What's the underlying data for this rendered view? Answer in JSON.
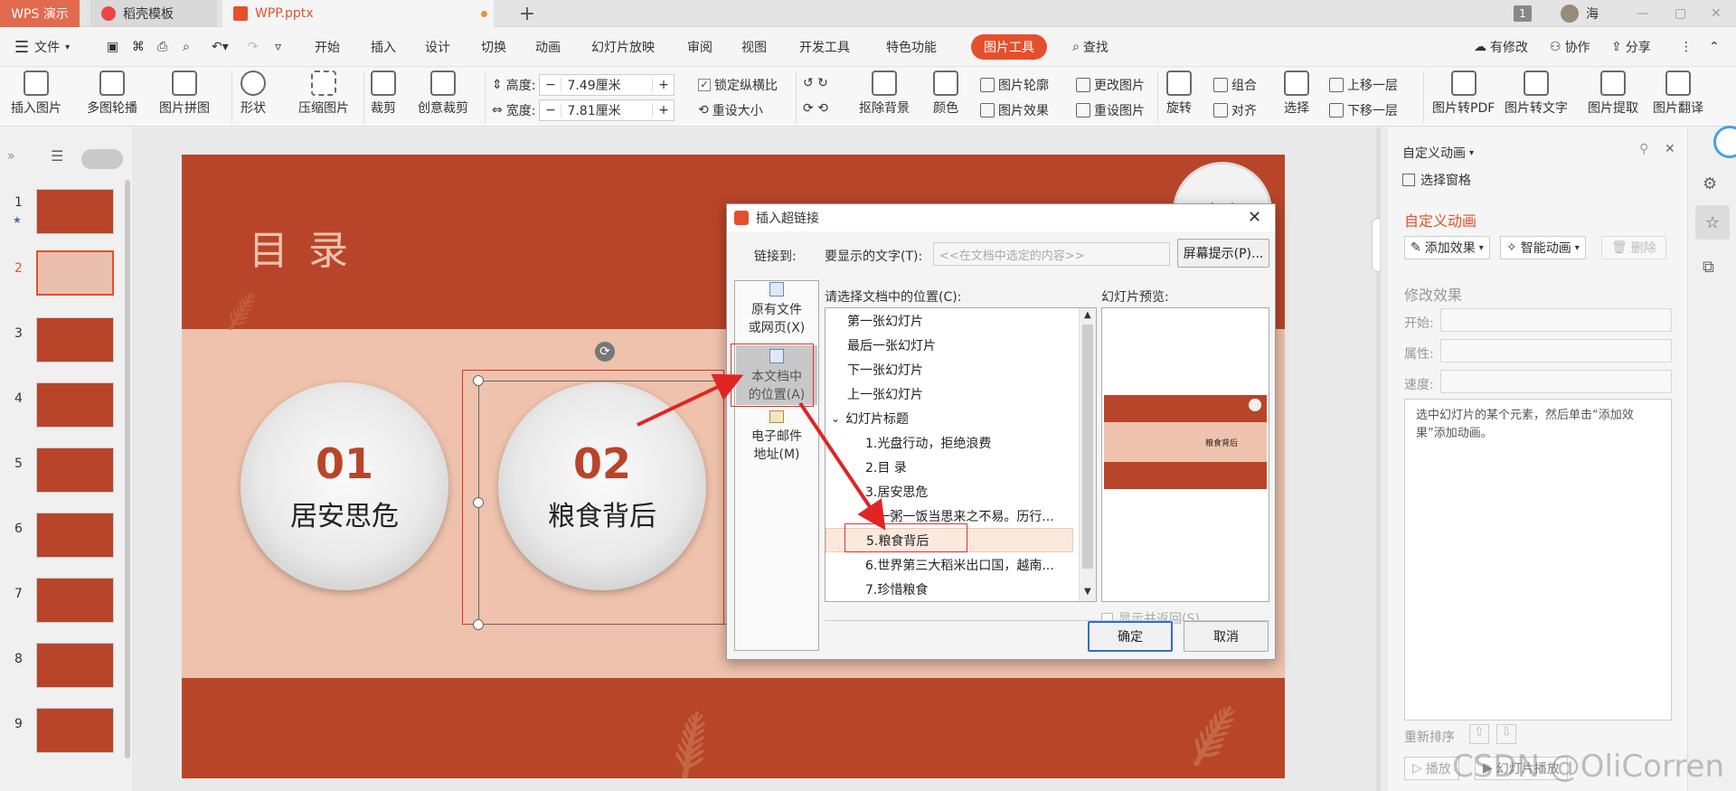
{
  "tabs": {
    "app": "WPS 演示",
    "template_tab": "稻壳模板",
    "doc_tab": "WPP.pptx",
    "add": "+"
  },
  "window": {
    "page_badge": "1",
    "user": "海"
  },
  "menu": {
    "file": "文件",
    "items": [
      "开始",
      "插入",
      "设计",
      "切换",
      "动画",
      "幻灯片放映",
      "审阅",
      "视图",
      "开发工具",
      "特色功能"
    ],
    "active_tool": "图片工具",
    "search": "查找",
    "right": [
      "有修改",
      "协作",
      "分享"
    ]
  },
  "ribbon": {
    "large": [
      "插入图片",
      "多图轮播",
      "图片拼图",
      "形状",
      "压缩图片",
      "裁剪",
      "创意裁剪"
    ],
    "height_label": "高度:",
    "height_value": "7.49厘米",
    "width_label": "宽度:",
    "width_value": "7.81厘米",
    "lock_ratio": "锁定纵横比",
    "reset_size": "重设大小",
    "large2": [
      "抠除背景",
      "颜色"
    ],
    "small": [
      "图片轮廓",
      "图片效果",
      "更改图片",
      "重设图片"
    ],
    "large3": [
      "旋转",
      "选择"
    ],
    "group": "组合",
    "align": "对齐",
    "up": "上移一层",
    "down": "下移一层",
    "large4": [
      "图片转PDF",
      "图片转文字",
      "图片提取",
      "图片翻译"
    ]
  },
  "thumbs": [
    "1",
    "2",
    "3",
    "4",
    "5",
    "6",
    "7",
    "8",
    "9"
  ],
  "slide": {
    "title": "目 录",
    "badge": "光盘",
    "items": [
      {
        "num": "01",
        "text": "居安思危"
      },
      {
        "num": "02",
        "text": "粮食背后"
      }
    ]
  },
  "dialog": {
    "title": "插入超链接",
    "link_to": "链接到:",
    "display_text_label": "要显示的文字(T):",
    "display_text_value": "<<在文档中选定的内容>>",
    "screentip": "屏幕提示(P)...",
    "nav": [
      {
        "label1": "原有文件",
        "label2": "或网页(X)"
      },
      {
        "label1": "本文档中",
        "label2": "的位置(A)"
      },
      {
        "label1": "电子邮件",
        "label2": "地址(M)"
      }
    ],
    "location_label": "请选择文档中的位置(C):",
    "list": [
      "第一张幻灯片",
      "最后一张幻灯片",
      "下一张幻灯片",
      "上一张幻灯片",
      "幻灯片标题",
      "1.光盘行动，拒绝浪费",
      "2.目 录",
      "3.居安思危",
      "4.一粥一饭当思来之不易。历行...",
      "5.粮食背后",
      "6.世界第三大稻米出口国，越南...",
      "7.珍惜粮食"
    ],
    "preview_label": "幻灯片预览:",
    "preview_text": "粮食背后",
    "show_return": "显示并返回(S)",
    "ok": "确定",
    "cancel": "取消"
  },
  "panel": {
    "header": "自定义动画",
    "select_pane": "选择窗格",
    "title": "自定义动画",
    "add_effect": "添加效果",
    "smart_anim": "智能动画",
    "delete": "删除",
    "modify": "修改效果",
    "start": "开始:",
    "property": "属性:",
    "speed": "速度:",
    "hint": "选中幻灯片的某个元素，然后单击“添加效果”添加动画。",
    "reorder": "重新排序",
    "play": "播放",
    "slideshow": "幻灯片播放"
  },
  "watermark": "CSDN @OliCorren",
  "colors": {
    "accent": "#b8452a",
    "tool_tab": "#e4502c",
    "selection": "#e03030"
  }
}
